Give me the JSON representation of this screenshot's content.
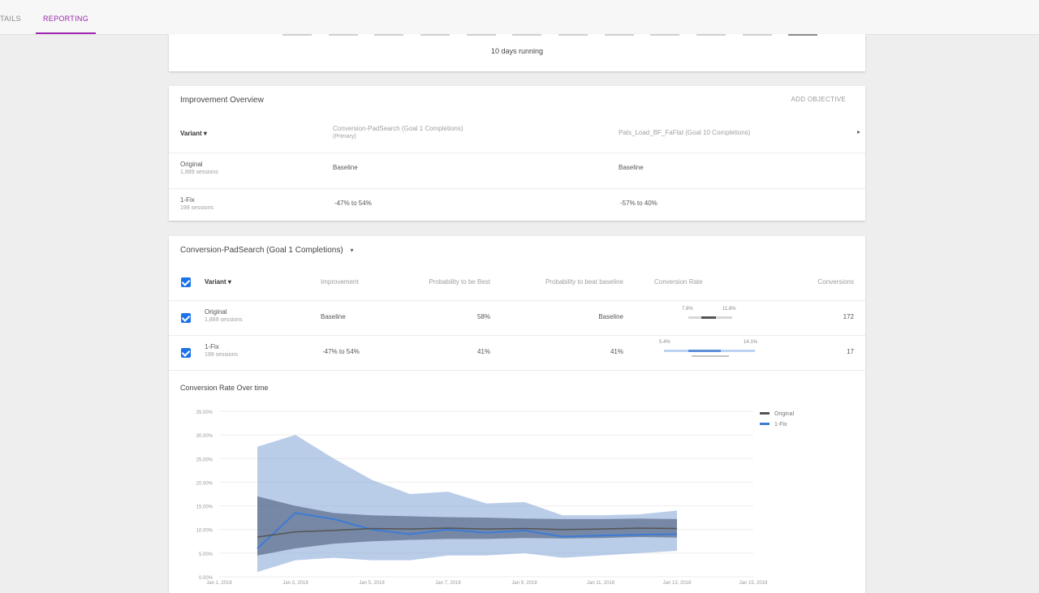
{
  "tabs": {
    "details": "TAILS",
    "reporting": "REPORTING"
  },
  "card1": {
    "weeks_text": "10 days running",
    "tick_count": 12,
    "active_tick": 11
  },
  "overview": {
    "title": "Improvement Overview",
    "link": "ADD OBJECTIVE",
    "header": {
      "variant": "Variant ▾",
      "col1": "Conversion-PadSearch (Goal 1 Completions)",
      "col1_sub": "(Primary)",
      "col2": "Pats_Load_BF_FaFlat (Goal 10 Completions)"
    },
    "rows": [
      {
        "name": "Original",
        "sub": "1,889 sessions",
        "col1": "Baseline",
        "col2": "Baseline"
      },
      {
        "name": "1-Fix",
        "sub": "199 sessions",
        "col1": "-47% to 54%",
        "col2": "-57% to 40%"
      }
    ],
    "caret": "▸"
  },
  "detail": {
    "title": "Conversion-PadSearch (Goal 1 Completions)",
    "title_caret": "▾",
    "headers": {
      "variant": "Variant ▾",
      "improvement": "Improvement",
      "prob_best": "Probability to be Best",
      "prob_beat": "Probability to beat baseline",
      "conv_rate": "Conversion Rate",
      "conversions": "Conversions"
    },
    "rows": [
      {
        "name": "Original",
        "sub": "1,889 sessions",
        "improvement": "Baseline",
        "prob_best": "58%",
        "prob_beat": "Baseline",
        "ci_low": "7.8%",
        "ci_high": "11.8%",
        "conversions": "172"
      },
      {
        "name": "1-Fix",
        "sub": "199 sessions",
        "improvement": "-47% to 54%",
        "prob_best": "41%",
        "prob_beat": "41%",
        "ci_low": "5.4%",
        "ci_high": "14.1%",
        "conversions": "17"
      }
    ],
    "chart_title": "Conversion Rate Over time"
  },
  "chart_data": {
    "type": "line",
    "title": "Conversion Rate Over time",
    "ylabel": "",
    "xlabel": "",
    "ylim": [
      0,
      35
    ],
    "yticks": [
      "0.00%",
      "5.00%",
      "10.00%",
      "15.00%",
      "20.00%",
      "25.00%",
      "30.00%",
      "35.00%"
    ],
    "xticks": [
      "Jan 1, 2018",
      "Jan 3, 2018",
      "Jan 5, 2018",
      "Jan 7, 2018",
      "Jan 9, 2018",
      "Jan 11, 2018",
      "Jan 13, 2018",
      "Jan 15, 2018"
    ],
    "x": [
      0.5,
      1,
      1.5,
      2,
      2.5,
      3,
      3.5,
      4,
      4.5,
      5,
      5.5,
      6
    ],
    "series": [
      {
        "name": "Original",
        "color": "#555555",
        "band_color": "#4a5a78",
        "values": [
          8.4,
          9.5,
          9.8,
          10.2,
          10.1,
          10.3,
          10.1,
          10.2,
          10.0,
          10.1,
          10.3,
          10.2
        ],
        "low": [
          4.5,
          6.0,
          7.0,
          7.5,
          7.8,
          8.0,
          8.0,
          8.2,
          8.1,
          8.2,
          8.4,
          8.3
        ],
        "high": [
          17.0,
          15.0,
          13.5,
          13.0,
          12.8,
          12.6,
          12.5,
          12.3,
          12.2,
          12.2,
          12.3,
          12.2
        ]
      },
      {
        "name": "1-Fix",
        "color": "#3d7bd6",
        "band_color": "#7fa3d6",
        "values": [
          6.0,
          13.5,
          12.2,
          10.0,
          9.0,
          10.0,
          9.3,
          9.8,
          8.5,
          8.7,
          8.9,
          9.0
        ],
        "low": [
          1.0,
          3.5,
          4.0,
          3.5,
          3.5,
          4.5,
          4.5,
          5.0,
          4.0,
          4.5,
          5.0,
          5.5
        ],
        "high": [
          27.5,
          30.0,
          25.0,
          20.5,
          17.5,
          18.0,
          15.5,
          15.8,
          13.0,
          13.0,
          13.2,
          14.0
        ]
      }
    ],
    "legend": "top-right",
    "grid": true
  }
}
